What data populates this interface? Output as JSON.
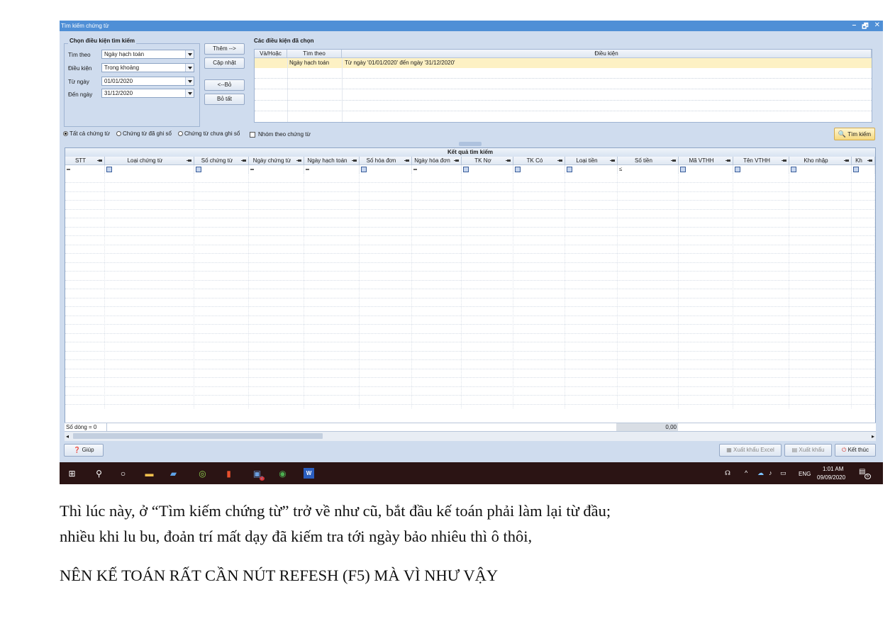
{
  "window": {
    "title": "Tìm kiếm chứng từ",
    "controls": [
      "–",
      "🗗",
      "✕"
    ]
  },
  "criteria": {
    "group_label": "Chọn điều kiện tìm kiếm",
    "search_by_label": "Tìm theo",
    "search_by_value": "Ngày hạch toán",
    "condition_label": "Điều kiện",
    "condition_value": "Trong khoảng",
    "from_label": "Từ ngày",
    "from_value": "01/01/2020",
    "to_label": "Đến ngày",
    "to_value": "31/12/2020"
  },
  "buttons": {
    "add": "Thêm -->",
    "update": "Cập nhật",
    "remove": "<--Bỏ",
    "remove_all": "Bỏ tất",
    "search": "Tìm kiếm"
  },
  "selected": {
    "group_label": "Các điều kiện đã chọn",
    "headers": [
      "Và/Hoặc",
      "Tìm theo",
      "Điều kiện"
    ],
    "rows": [
      {
        "andor": "",
        "field": "Ngày hạch toán",
        "condition": "Từ ngày '01/01/2020' đến ngày '31/12/2020'"
      }
    ]
  },
  "options": {
    "radio_all": "Tất cả chứng từ",
    "radio_posted": "Chứng từ đã ghi sổ",
    "radio_unposted": "Chứng từ chưa ghi sổ",
    "group_checkbox": "Nhóm theo chứng từ"
  },
  "results": {
    "title": "Kết quả tìm kiếm",
    "columns": [
      "STT",
      "Loại chứng từ",
      "Số chứng từ",
      "Ngày chứng từ",
      "Ngày hạch toán",
      "Số hóa đơn",
      "Ngày hóa đơn",
      "TK Nợ",
      "TK Có",
      "Loại tiền",
      "Số tiền",
      "Mã VTHH",
      "Tên VTHH",
      "Kho nhập",
      "Kh"
    ],
    "filter_ops": [
      "=",
      "box",
      "box",
      "=",
      "=",
      "box",
      "=",
      "box",
      "box",
      "box",
      "≤",
      "box",
      "box",
      "box",
      "box"
    ],
    "row_count": "Số dòng = 0",
    "total": "0,00"
  },
  "bottom": {
    "help": "Giúp",
    "export_excel": "Xuất khẩu Excel",
    "export": "Xuất khẩu",
    "close": "Kết thúc"
  },
  "taskbar": {
    "time": "1:01 AM",
    "date": "09/09/2020",
    "lang": "ENG",
    "notif": "5",
    "badge": "2"
  },
  "text": {
    "line1": "Thì lúc này, ở “Tìm kiếm chứng từ” trở về như cũ, bắt đầu kế toán phải làm lại từ đầu;",
    "line2": "nhiều khi lu bu, đoản trí mất dạy đã kiếm tra tới ngày bảo nhiêu thì ô thôi,",
    "line3": "NÊN KẾ TOÁN RẤT CẦN NÚT REFESH (F5) MÀ VÌ NHƯ VẬY"
  }
}
